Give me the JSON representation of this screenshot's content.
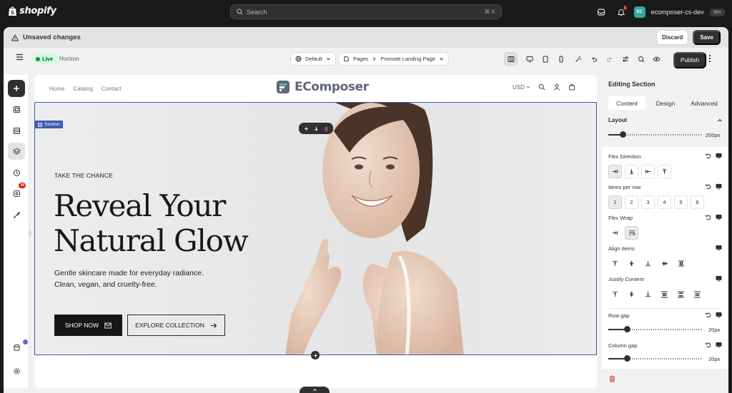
{
  "topbar": {
    "logo_text": "shopify",
    "search_placeholder": "Search",
    "search_shortcut": "⌘ K",
    "notification_count": "1",
    "store_avatar": "EC",
    "store_name": "ecomposer-cs-dev",
    "store_badge": "dev"
  },
  "unsaved": {
    "title": "Unsaved changes",
    "discard_label": "Discard",
    "save_label": "Save"
  },
  "toolbar": {
    "status": "Live",
    "theme": "Horizon",
    "template": "Default",
    "breadcrumb_root": "Pages",
    "breadcrumb_page": "Promote Landing Page",
    "publish_label": "Publish"
  },
  "rail": {
    "badge_count": "34"
  },
  "store": {
    "nav": [
      "Home",
      "Catalog",
      "Contact"
    ],
    "brand": "EComposer",
    "currency": "USD",
    "section_tag": "Section",
    "hero": {
      "eyebrow": "TAKE THE CHANCE",
      "headline_1": "Reveal Your",
      "headline_2": "Natural Glow",
      "sub_1": "Gentle skincare made for everyday radiance.",
      "sub_2": "Clean, vegan, and cruelty-free.",
      "cta_primary": "SHOP NOW",
      "cta_secondary": "EXPLORE COLLECTION"
    }
  },
  "panel": {
    "title": "Editing Section",
    "tabs": [
      "Content",
      "Design",
      "Advanced"
    ],
    "active_tab": "Content",
    "layout_label": "Layout",
    "layout_width": {
      "value": "200px",
      "fraction": 0.15
    },
    "flex_direction_label": "Flex Direction",
    "items_per_row_label": "Items per row",
    "items_per_row_options": [
      "1",
      "2",
      "3",
      "4",
      "5",
      "6"
    ],
    "items_per_row_selected": "1",
    "flex_wrap_label": "Flex Wrap",
    "align_items_label": "Align items",
    "justify_content_label": "Justify Content",
    "row_gap_label": "Row gap",
    "row_gap": {
      "value": "20px",
      "fraction": 0.2
    },
    "column_gap_label": "Column gap",
    "column_gap": {
      "value": "20px",
      "fraction": 0.2
    }
  },
  "colors": {
    "selection_outline": "#3f5bb3",
    "live_badge_bg": "#cdfed4",
    "primary_dark": "#303030",
    "notification": "#e51c00"
  }
}
